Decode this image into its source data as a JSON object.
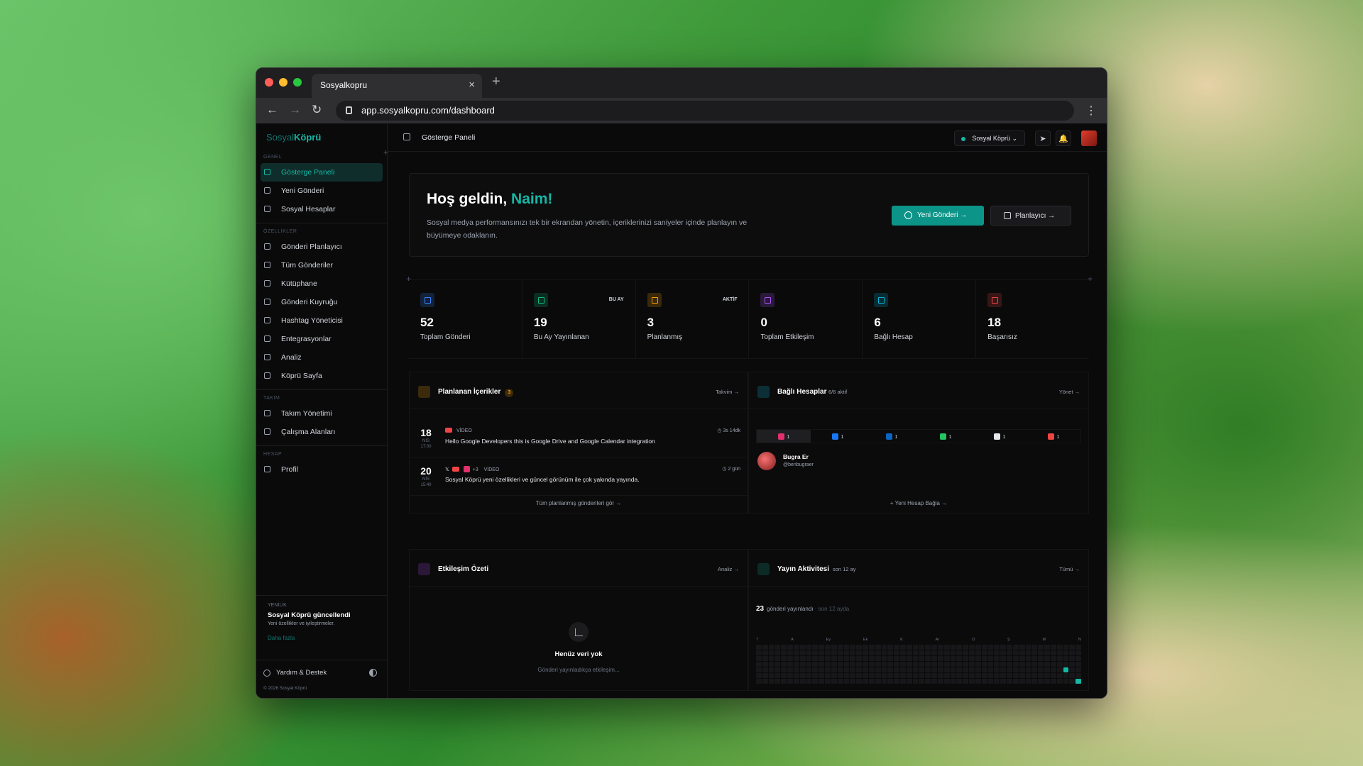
{
  "browser": {
    "tab_title": "Sosyalkopru",
    "url": "app.sosyalkopru.com/dashboard"
  },
  "sidebar": {
    "logo_part1": "Sosyal",
    "logo_part2": "Köprü",
    "sections": [
      {
        "title": "GENEL",
        "items": [
          {
            "label": "Gösterge Paneli",
            "icon": "dashboard-icon",
            "active": true
          },
          {
            "label": "Yeni Gönderi",
            "icon": "plus-circle-icon"
          },
          {
            "label": "Sosyal Hesaplar",
            "icon": "share-icon"
          }
        ]
      },
      {
        "title": "ÖZELLİKLER",
        "items": [
          {
            "label": "Gönderi Planlayıcı",
            "icon": "calendar-icon"
          },
          {
            "label": "Tüm Gönderiler",
            "icon": "file-icon"
          },
          {
            "label": "Kütüphane",
            "icon": "library-icon"
          },
          {
            "label": "Gönderi Kuyruğu",
            "icon": "queue-icon"
          },
          {
            "label": "Hashtag Yöneticisi",
            "icon": "hash-icon"
          },
          {
            "label": "Entegrasyonlar",
            "icon": "puzzle-icon"
          },
          {
            "label": "Analiz",
            "icon": "chart-icon"
          },
          {
            "label": "Köprü Sayfa",
            "icon": "globe-icon"
          }
        ]
      },
      {
        "title": "TAKIM",
        "items": [
          {
            "label": "Takım Yönetimi",
            "icon": "users-icon"
          },
          {
            "label": "Çalışma Alanları",
            "icon": "building-icon"
          }
        ]
      },
      {
        "title": "HESAP",
        "items": [
          {
            "label": "Profil",
            "icon": "user-icon"
          }
        ]
      }
    ],
    "news": {
      "tag": "YENİLİK",
      "title": "Sosyal Köprü güncellendi",
      "desc": "Yeni özellikler ve iyileştirmeler.",
      "link": "Daha fazla"
    },
    "help": "Yardım & Destek",
    "copyright": "© 2026 Sosyal Köprü"
  },
  "topbar": {
    "title": "Gösterge Paneli",
    "workspace": "Sosyal Köprü"
  },
  "welcome": {
    "greeting": "Hoş geldin,",
    "name": "Naim!",
    "desc": "Sosyal medya performansınızı tek bir ekrandan yönetin, içeriklerinizi saniyeler içinde planlayın ve büyümeye odaklanın.",
    "btn_new": "Yeni Gönderi",
    "btn_planner": "Planlayıcı"
  },
  "stats": [
    {
      "value": "52",
      "label": "Toplam Gönderi",
      "tag": "",
      "color": "#3b82f6",
      "icon": "send-icon"
    },
    {
      "value": "19",
      "label": "Bu Ay Yayınlanan",
      "tag": "BU AY",
      "color": "#10b981",
      "icon": "calendar-check-icon"
    },
    {
      "value": "3",
      "label": "Planlanmış",
      "tag": "AKTİF",
      "color": "#f59e0b",
      "icon": "clock-icon"
    },
    {
      "value": "0",
      "label": "Toplam Etkileşim",
      "tag": "",
      "color": "#a855f7",
      "icon": "trend-icon"
    },
    {
      "value": "6",
      "label": "Bağlı Hesap",
      "tag": "",
      "color": "#06b6d4",
      "icon": "link-icon"
    },
    {
      "value": "18",
      "label": "Başarısız",
      "tag": "",
      "color": "#ef4444",
      "icon": "alert-icon"
    }
  ],
  "scheduled": {
    "title": "Planlanan İçerikler",
    "count": "3",
    "link": "Takvim →",
    "footer": "Tüm planlanmış gönderileri gör →",
    "posts": [
      {
        "day": "18",
        "month": "NİS",
        "time": "17:00",
        "type": "VİDEO",
        "text": "Hello Google Developers this is Google Drive and Google Calendar integration",
        "when": "3s 14dk",
        "extra": ""
      },
      {
        "day": "20",
        "month": "NİS",
        "time": "15:40",
        "type": "VİDEO",
        "text": "Sosyal Köprü yeni özellikleri ve güncel görünüm ile çok yakında yayında.",
        "when": "2 gün",
        "extra": "+3"
      }
    ]
  },
  "accounts": {
    "title": "Bağlı Hesaplar",
    "count": "6/6 aktif",
    "link": "Yönet →",
    "footer": "+ Yeni Hesap Bağla →",
    "platforms": [
      {
        "count": "1",
        "color": "#e1306c",
        "icon": "instagram-icon"
      },
      {
        "count": "1",
        "color": "#1877f2",
        "icon": "facebook-icon"
      },
      {
        "count": "1",
        "color": "#0a66c2",
        "icon": "linkedin-icon"
      },
      {
        "count": "1",
        "color": "#22c55e",
        "icon": "threads-icon"
      },
      {
        "count": "1",
        "color": "#e5e7eb",
        "icon": "x-icon"
      },
      {
        "count": "1",
        "color": "#ef4444",
        "icon": "youtube-icon"
      }
    ],
    "account": {
      "name": "Bugra Er",
      "handle": "@benbugraer"
    }
  },
  "engagement": {
    "title": "Etkileşim Özeti",
    "link": "Analiz →",
    "empty_title": "Henüz veri yok",
    "empty_desc": "Gönderi yayınladıkça etkileşim..."
  },
  "activity": {
    "title": "Yayın Aktivitesi",
    "subtitle": "son 12 ay",
    "link": "Tümü →",
    "count": "23",
    "count_label": "gönderi yayınlandı",
    "count_suffix": "· son 12 ayda",
    "months": [
      "T",
      "A",
      "Ey",
      "Ek",
      "K",
      "Ar",
      "O",
      "Ş",
      "M",
      "N"
    ]
  }
}
